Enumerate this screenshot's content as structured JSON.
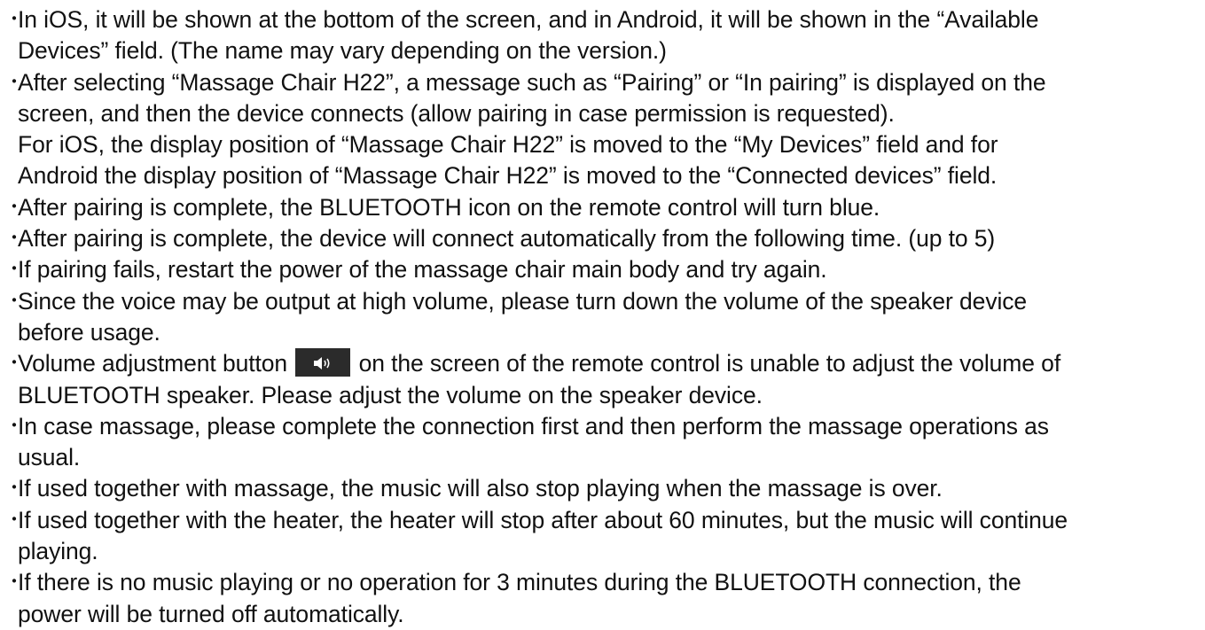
{
  "bullet_symbol": "・",
  "lines": {
    "l0": "In iOS, it will be shown at the bottom of the screen, and in Android, it will be shown in the “Available",
    "l1": "Devices” field. (The name may vary depending on the version.)",
    "l2": "After selecting “Massage Chair H22”, a message such as “Pairing” or “In pairing” is displayed on the",
    "l3": "screen, and then the device connects (allow pairing in case permission is requested).",
    "l4": "For iOS, the display position of “Massage Chair H22” is moved to the “My Devices” field and for",
    "l5": "Android the display position of “Massage Chair H22” is moved to the “Connected devices” field.",
    "l6": "After pairing is complete, the BLUETOOTH icon on the remote control will turn blue.",
    "l7": "After pairing is complete, the device will connect automatically from the following time. (up to 5)",
    "l8": "If pairing fails, restart the power of the massage chair main body and try again.",
    "l9": "Since the voice may be output at high volume, please turn down the volume of the speaker device",
    "l10": "before usage.",
    "l11a": "Volume adjustment button",
    "l11b": "on the screen of the remote control is unable to adjust the volume of",
    "l12": "BLUETOOTH speaker. Please adjust the volume on the speaker device.",
    "l13": "In case massage, please complete the connection first and then perform the massage operations as",
    "l14": "usual.",
    "l15": "If used together with massage, the music will also stop playing when the massage is over.",
    "l16": "If used together with the heater, the heater will stop after about 60 minutes, but the music will continue",
    "l17": "playing.",
    "l18": "If there is no music playing or no operation for 3 minutes during the BLUETOOTH connection, the",
    "l19": "power will be turned off automatically."
  },
  "icons": {
    "volume_button": "speaker-volume-icon"
  }
}
